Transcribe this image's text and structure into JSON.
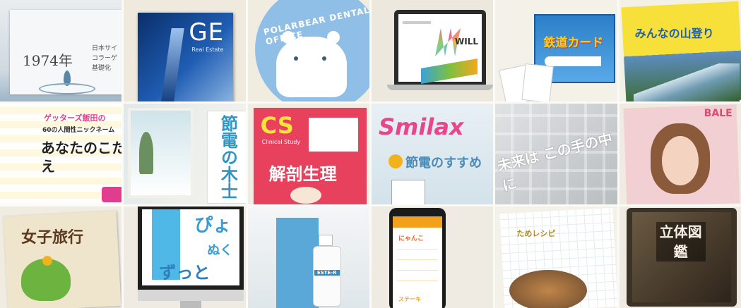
{
  "tiles": [
    {
      "title": "1974年",
      "sub": "日本サイ コラーゲ 基礎化"
    },
    {
      "title": "GE",
      "sub": "Real Estate"
    },
    {
      "title": "POLARBEAR DENTAL OFFICE"
    },
    {
      "title": "WILL"
    },
    {
      "title": "鉄道カード"
    },
    {
      "title": "みんなの山登り"
    },
    {
      "title": "ゲッターズ飯田の",
      "sub": "60の人間性ニックネーム",
      "big": "あなたのこたえ"
    },
    {
      "title": "節電の木士"
    },
    {
      "title": "CS",
      "sub": "解剖生理",
      "small": "Clinical Study"
    },
    {
      "title": "Smilax",
      "sub": "節電のすすめ"
    },
    {
      "title": "未来は この手の中に"
    },
    {
      "title": "BALE"
    },
    {
      "title": "女子旅行"
    },
    {
      "title": "ずっと",
      "sub": "ぴょ",
      "small": "ぬく"
    },
    {
      "title": "ESTE-R"
    },
    {
      "title": "にゃんこ",
      "sub": "ステーキ"
    },
    {
      "title": "ためレシピ"
    },
    {
      "title": "立体図鑑"
    }
  ],
  "colors": {
    "bg": "#f3efe4"
  }
}
